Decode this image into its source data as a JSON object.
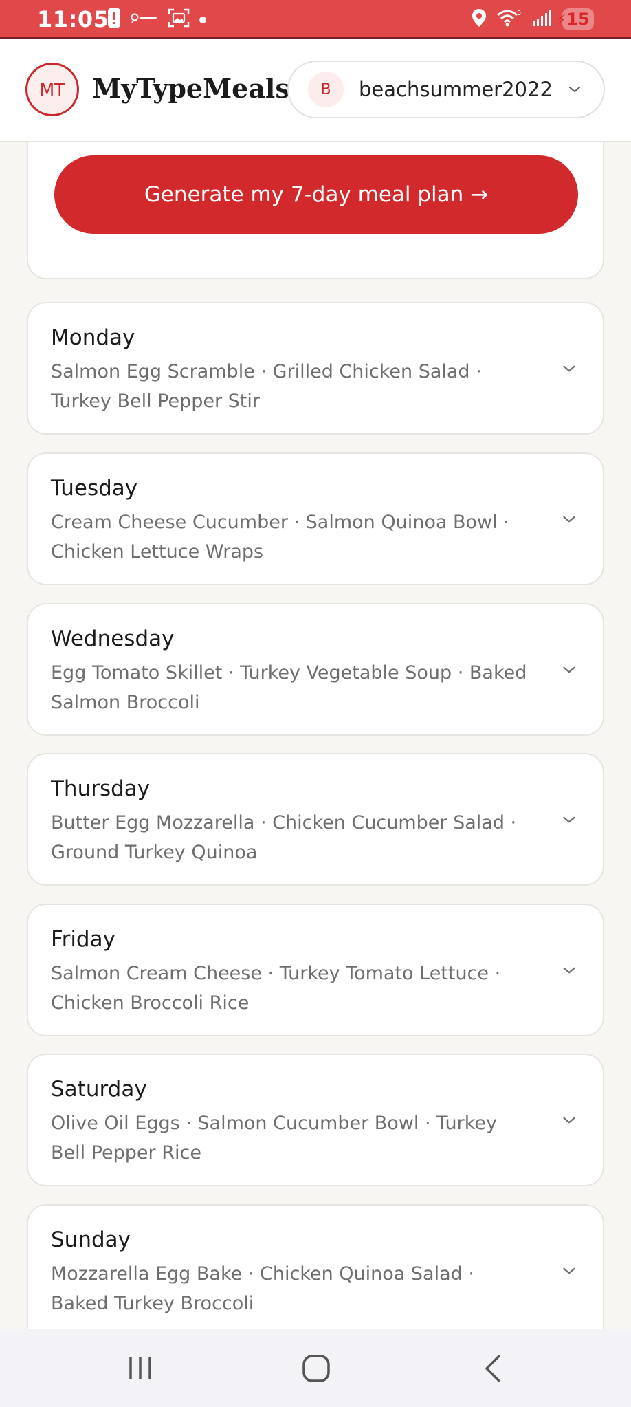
{
  "status_bar": {
    "time": "11:05",
    "battery_level": "15",
    "background_color": "#e0484a"
  },
  "header": {
    "logo_initials": "MT",
    "app_title": "MyTypeMeals",
    "account": {
      "avatar_initial": "B",
      "username": "beachsummer2022"
    }
  },
  "generate_button_label": "Generate my 7-day meal plan →",
  "days": [
    {
      "name": "Monday",
      "meals": "Salmon Egg Scramble · Grilled Chicken Salad · Turkey Bell Pepper Stir"
    },
    {
      "name": "Tuesday",
      "meals": "Cream Cheese Cucumber · Salmon Quinoa Bowl · Chicken Lettuce Wraps"
    },
    {
      "name": "Wednesday",
      "meals": "Egg Tomato Skillet · Turkey Vegetable Soup · Baked Salmon Broccoli"
    },
    {
      "name": "Thursday",
      "meals": "Butter Egg Mozzarella · Chicken Cucumber Salad · Ground Turkey Quinoa"
    },
    {
      "name": "Friday",
      "meals": "Salmon Cream Cheese · Turkey Tomato Lettuce · Chicken Broccoli Rice"
    },
    {
      "name": "Saturday",
      "meals": "Olive Oil Eggs · Salmon Cucumber Bowl · Turkey Bell Pepper Rice"
    },
    {
      "name": "Sunday",
      "meals": "Mozzarella Egg Bake · Chicken Quinoa Salad · Baked Turkey Broccoli"
    }
  ],
  "colors": {
    "accent": "#d2292c",
    "card_border": "#e7e5e1",
    "page_background": "#f7f6f3",
    "meal_text": "#6e6e6e"
  }
}
